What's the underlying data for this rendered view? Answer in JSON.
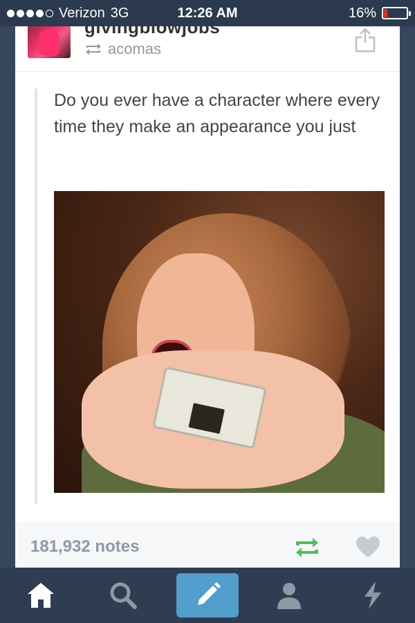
{
  "status_bar": {
    "signal_dots": 4,
    "signal_dots_total": 5,
    "carrier": "Verizon",
    "network": "3G",
    "time": "12:26 AM",
    "battery_text": "16%",
    "battery_level": 0.16,
    "battery_color": "#e22a2a"
  },
  "post": {
    "blog_name": "givingblowjobs",
    "reblogged_from": "acomas",
    "text": "Do you ever have a character where every time they make an appearance you just",
    "notes": "181,932 notes"
  },
  "tab_bar": {
    "tabs": [
      "home-icon",
      "search-icon",
      "compose-icon",
      "account-icon",
      "activity-icon"
    ],
    "active_color": "#529ecc"
  },
  "colors": {
    "background": "#36465d",
    "reblog_green": "#56bc5e",
    "muted_text": "#8e99a5"
  }
}
